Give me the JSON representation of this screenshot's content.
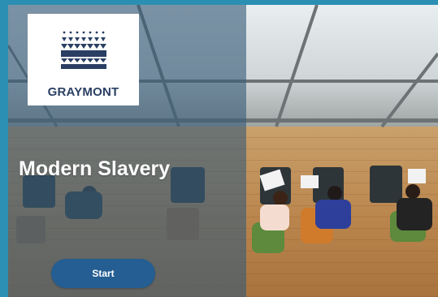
{
  "logo": {
    "brand_text": "GRAYMONT"
  },
  "hero": {
    "title": "Modern Slavery"
  },
  "actions": {
    "start_label": "Start"
  },
  "colors": {
    "frame": "#2b8fb3",
    "button": "#245e92",
    "logo_text": "#2a3f63",
    "overlay": "#375a78"
  }
}
